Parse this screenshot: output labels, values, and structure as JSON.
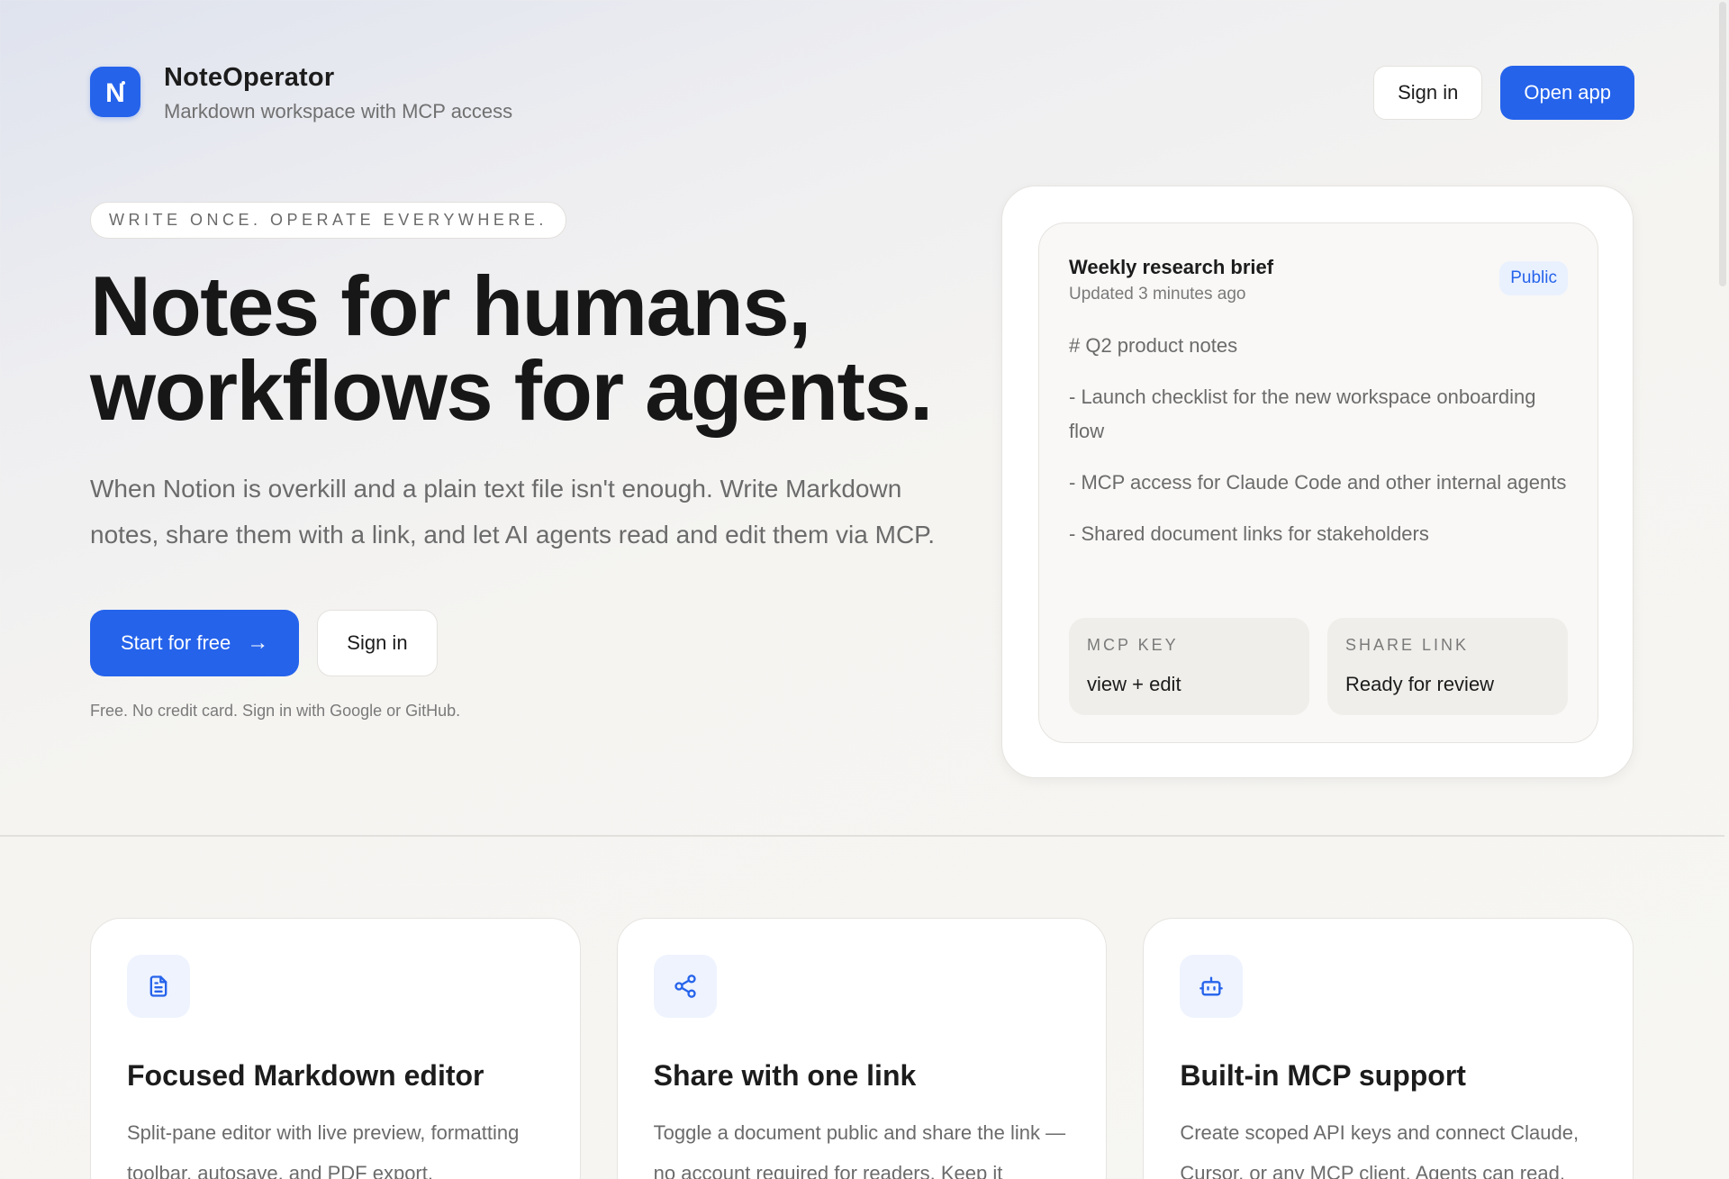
{
  "header": {
    "brand_name": "NoteOperator",
    "brand_tagline": "Markdown workspace with MCP access",
    "logo_letter": "N",
    "sign_in_label": "Sign in",
    "open_app_label": "Open app"
  },
  "hero": {
    "eyebrow": "WRITE ONCE. OPERATE EVERYWHERE.",
    "headline_line1": "Notes for humans,",
    "headline_line2": "workflows for agents.",
    "lead": "When Notion is overkill and a plain text file isn't enough. Write Markdown notes, share them with a link, and let AI agents read and edit them via MCP.",
    "primary_cta": "Start for free",
    "primary_cta_arrow": "→",
    "secondary_cta": "Sign in",
    "fineprint": "Free. No credit card. Sign in with Google or GitHub."
  },
  "preview": {
    "title": "Weekly research brief",
    "updated": "Updated 3 minutes ago",
    "badge": "Public",
    "lines": [
      "# Q2 product notes",
      "- Launch checklist for the new workspace onboarding flow",
      "- MCP access for Claude Code and other internal agents",
      "- Shared document links for stakeholders"
    ],
    "chips": [
      {
        "label": "MCP KEY",
        "value": "view + edit"
      },
      {
        "label": "SHARE LINK",
        "value": "Ready for review"
      }
    ]
  },
  "features": [
    {
      "icon": "document-icon",
      "title": "Focused Markdown editor",
      "desc": "Split-pane editor with live preview, formatting toolbar, autosave, and PDF export."
    },
    {
      "icon": "share-icon",
      "title": "Share with one link",
      "desc": "Toggle a document public and share the link — no account required for readers. Keep it"
    },
    {
      "icon": "robot-icon",
      "title": "Built-in MCP support",
      "desc": "Create scoped API keys and connect Claude, Cursor, or any MCP client. Agents can read,"
    }
  ],
  "colors": {
    "accent": "#2563eb",
    "badge_bg": "#eaf1fe",
    "text_primary": "#1c1c1c",
    "text_muted": "#6b6b6b"
  }
}
